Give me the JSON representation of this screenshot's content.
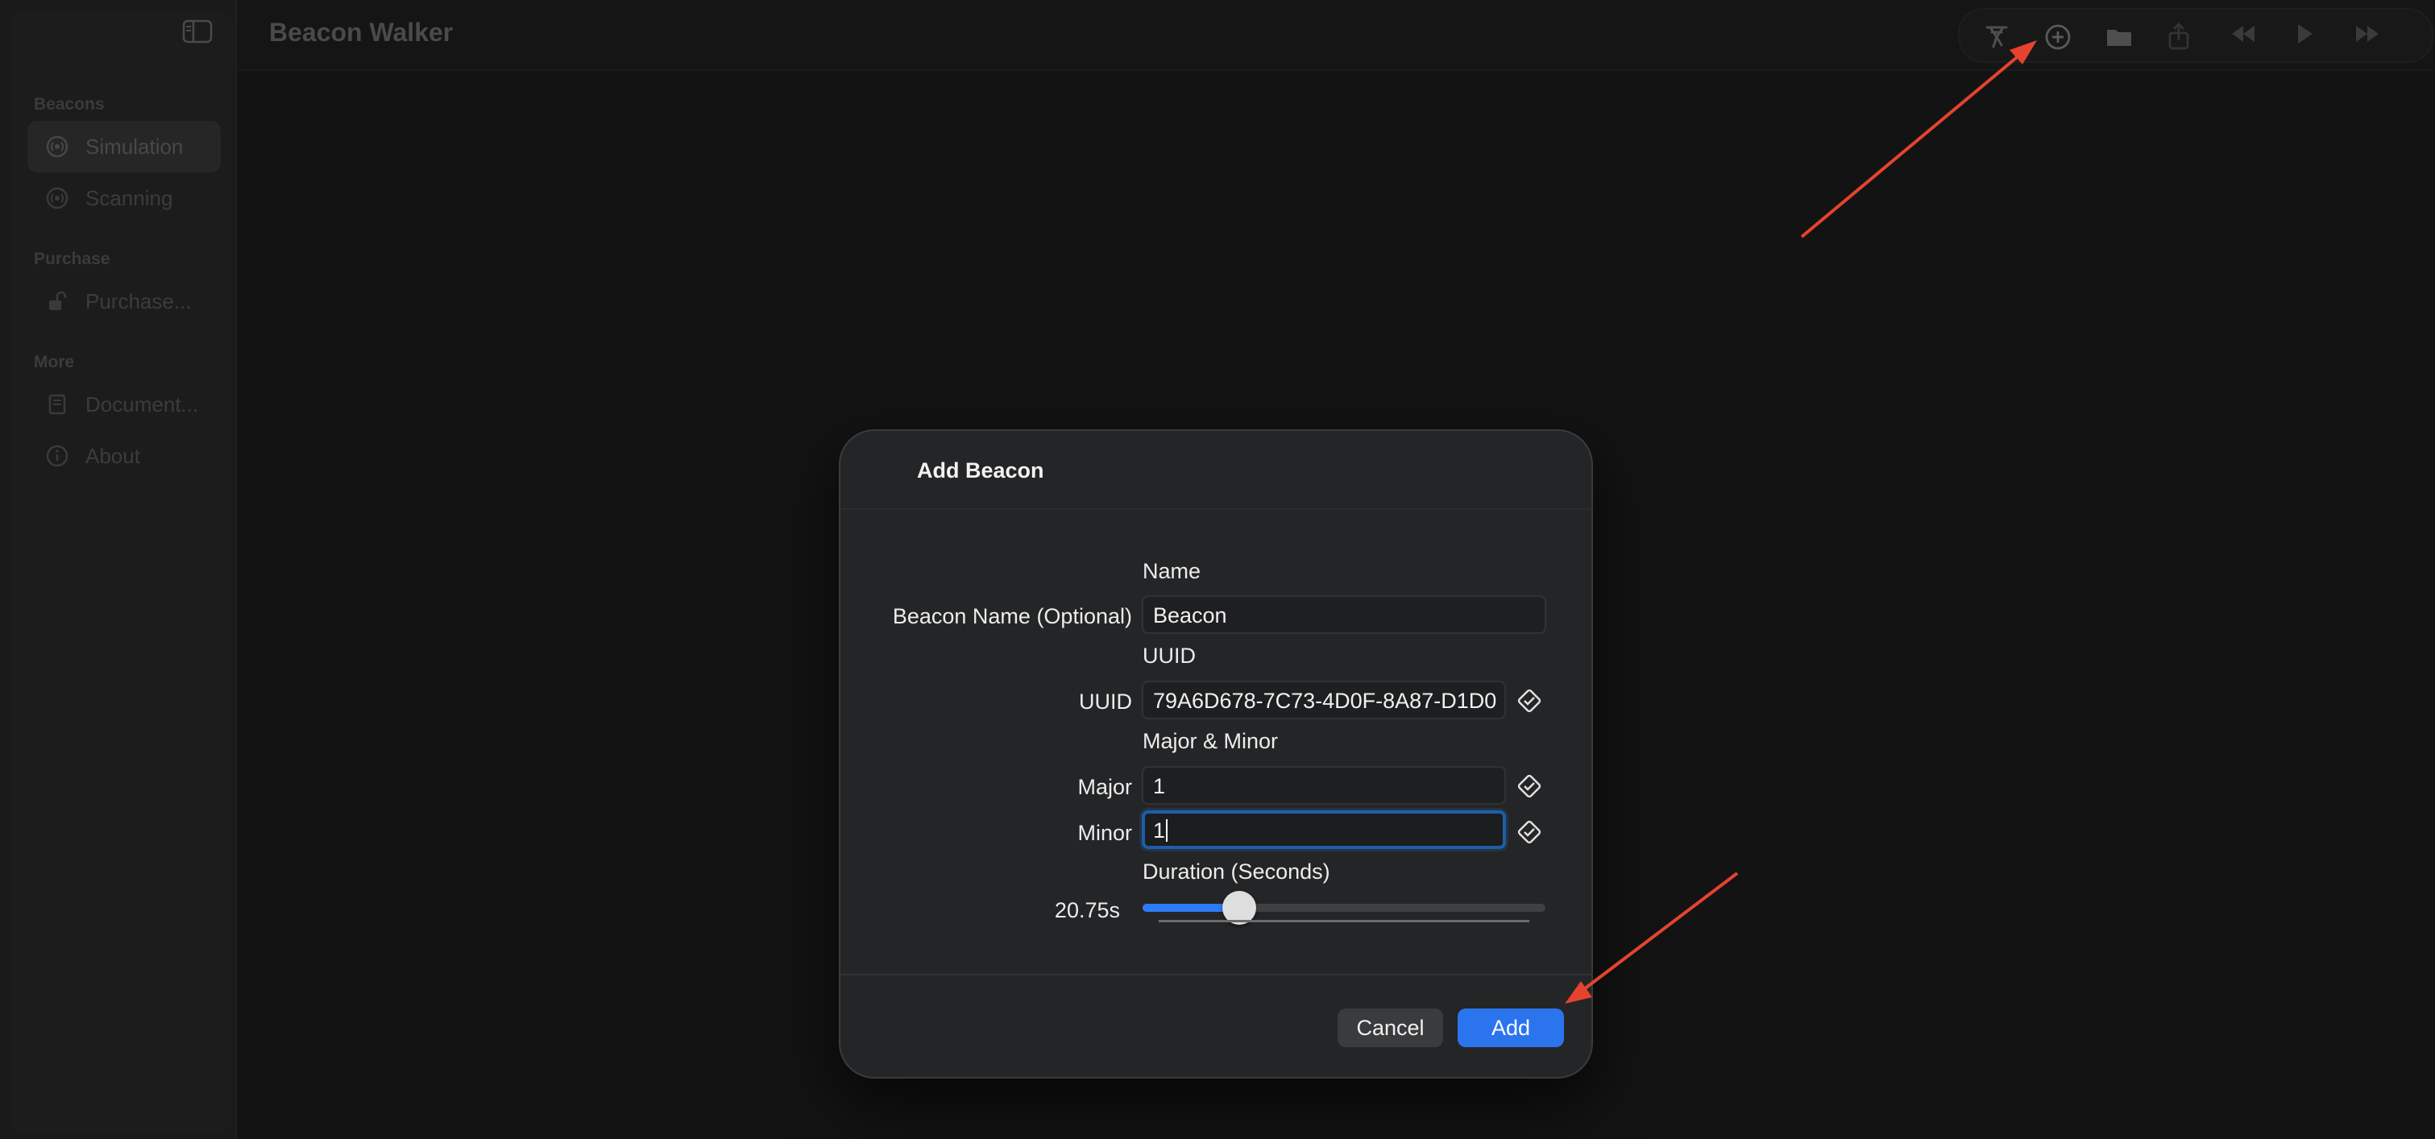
{
  "app": {
    "title": "Beacon Walker"
  },
  "sidebar": {
    "sections": [
      {
        "header": "Beacons",
        "items": [
          {
            "label": "Simulation",
            "icon": "antenna-icon",
            "selected": true
          },
          {
            "label": "Scanning",
            "icon": "antenna-icon",
            "selected": false
          }
        ]
      },
      {
        "header": "Purchase",
        "items": [
          {
            "label": "Purchase...",
            "icon": "unlock-icon",
            "selected": false
          }
        ]
      },
      {
        "header": "More",
        "items": [
          {
            "label": "Document...",
            "icon": "book-icon",
            "selected": false
          },
          {
            "label": "About",
            "icon": "info-icon",
            "selected": false
          }
        ]
      }
    ]
  },
  "toolbar": {
    "icons": [
      "walker-icon",
      "add-circle-icon",
      "folder-icon",
      "share-icon",
      "rewind-icon",
      "play-icon",
      "fast-forward-icon"
    ]
  },
  "dialog": {
    "title": "Add Beacon",
    "name_section": "Name",
    "name_label": "Beacon Name (Optional)",
    "name_value": "Beacon",
    "uuid_section": "UUID",
    "uuid_label": "UUID",
    "uuid_value": "79A6D678-7C73-4D0F-8A87-D1D0",
    "major_minor_section": "Major & Minor",
    "major_label": "Major",
    "major_value": "1",
    "minor_label": "Minor",
    "minor_value": "1",
    "duration_section": "Duration (Seconds)",
    "duration_value_label": "20.75s",
    "duration_fraction": 0.24,
    "cancel_label": "Cancel",
    "add_label": "Add"
  },
  "colors": {
    "accent": "#2a74ee",
    "annotation_arrow": "#e5432f"
  }
}
